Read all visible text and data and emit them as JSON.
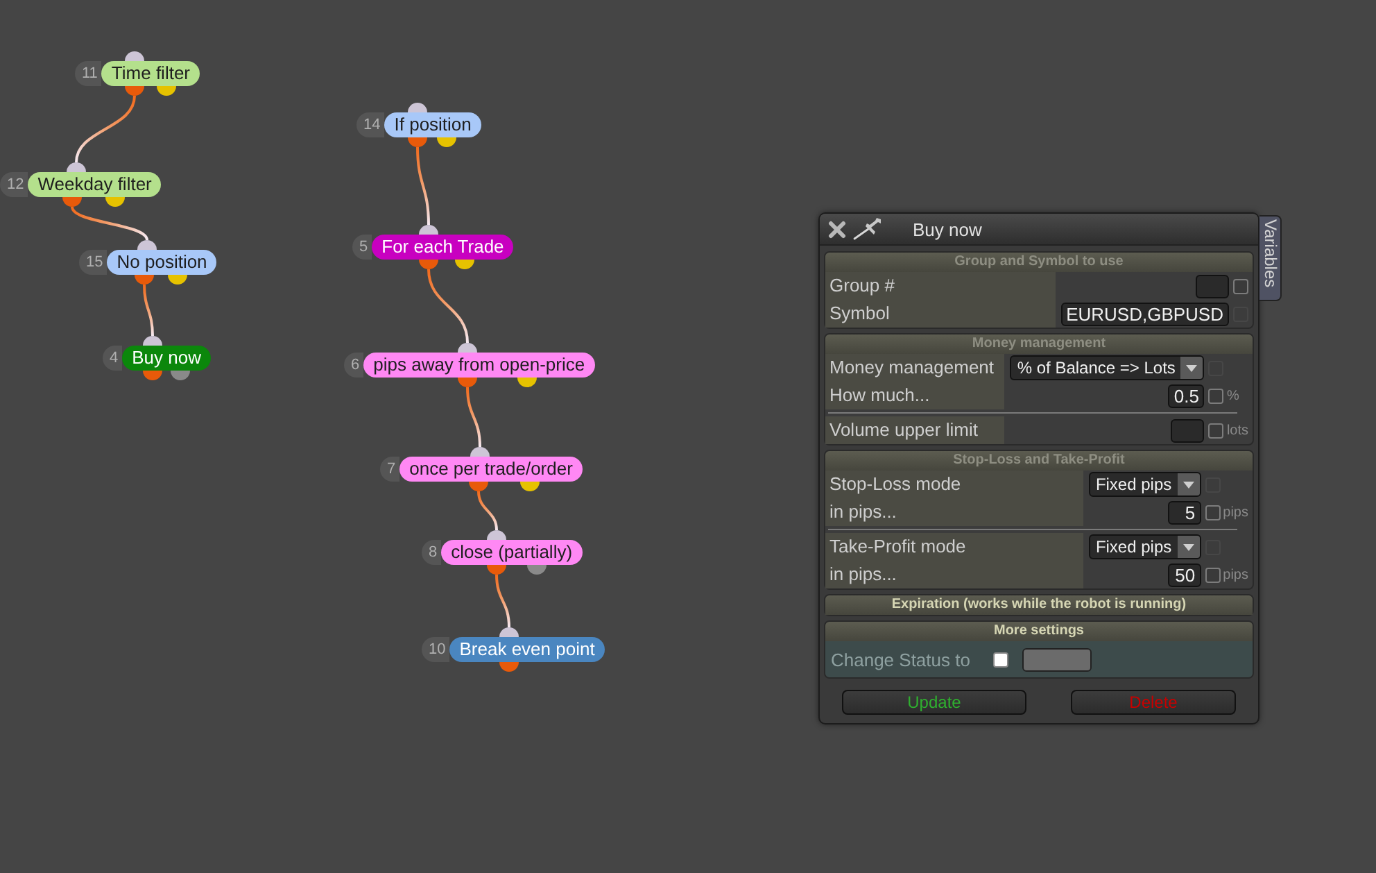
{
  "canvas": {
    "flows": [
      {
        "nodes": [
          {
            "number": "11",
            "label": "Time filter",
            "color": "#b4e08c",
            "outputs": [
              {
                "color": "#e85a0a"
              },
              {
                "color": "#e6c200"
              }
            ]
          },
          {
            "number": "12",
            "label": "Weekday filter",
            "color": "#b4e08c",
            "outputs": [
              {
                "color": "#e85a0a"
              },
              {
                "color": "#e6c200"
              }
            ]
          },
          {
            "number": "15",
            "label": "No position",
            "color": "#a8c8f8",
            "outputs": [
              {
                "color": "#e85a0a"
              },
              {
                "color": "#e6c200"
              }
            ]
          },
          {
            "number": "4",
            "label": "Buy now",
            "color": "#0b870b",
            "outputs": [
              {
                "color": "#e85a0a"
              },
              {
                "color": "#8a8a8a"
              }
            ]
          }
        ]
      },
      {
        "nodes": [
          {
            "number": "14",
            "label": "If position",
            "color": "#a8c8f8",
            "outputs": [
              {
                "color": "#e85a0a"
              },
              {
                "color": "#e6c200"
              }
            ]
          },
          {
            "number": "5",
            "label": "For each Trade",
            "color": "#c800c0",
            "outputs": [
              {
                "color": "#e85a0a"
              },
              {
                "color": "#e6c200"
              }
            ]
          },
          {
            "number": "6",
            "label": "pips away from open-price",
            "color": "#ff88f4",
            "outputs": [
              {
                "color": "#e85a0a"
              },
              {
                "color": "#e6c200"
              }
            ]
          },
          {
            "number": "7",
            "label": "once per trade/order",
            "color": "#ff88f4",
            "outputs": [
              {
                "color": "#e85a0a"
              },
              {
                "color": "#e6c200"
              }
            ]
          },
          {
            "number": "8",
            "label": "close (partially)",
            "color": "#ff88f4",
            "outputs": [
              {
                "color": "#e85a0a"
              },
              {
                "color": "#8a8a8a"
              }
            ]
          },
          {
            "number": "10",
            "label": "Break even point",
            "color": "#4a86c0",
            "outputs": [
              {
                "color": "#e85a0a"
              }
            ]
          }
        ]
      }
    ]
  },
  "panel": {
    "title": "Buy now",
    "side_tab": "Variables",
    "sections": [
      {
        "title": "Group and Symbol to use",
        "dimmed": true,
        "groups": [
          {
            "rows": [
              {
                "kind": "text",
                "label": "Group #",
                "checkbox": {
                  "checked": false,
                  "disabled": false
                }
              },
              {
                "kind": "text",
                "label": "Symbol",
                "value": "EURUSD,GBPUSD",
                "checkbox": {
                  "checked": false,
                  "disabled": true
                }
              }
            ]
          }
        ]
      },
      {
        "title": "Money management",
        "dimmed": true,
        "groups": [
          {
            "rows": [
              {
                "kind": "select",
                "label": "Money management",
                "value": "% of Balance => Lots",
                "checkbox": {
                  "checked": false,
                  "disabled": true
                }
              },
              {
                "kind": "text",
                "label": "How much...",
                "value": "0.5",
                "checkbox": {
                  "checked": false,
                  "disabled": false
                },
                "unit": "%"
              }
            ]
          },
          {
            "rows": [
              {
                "kind": "text",
                "label": "Volume upper limit",
                "checkbox": {
                  "checked": false,
                  "disabled": false
                },
                "unit": "lots"
              }
            ]
          }
        ]
      },
      {
        "title": "Stop-Loss and Take-Profit",
        "dimmed": true,
        "groups": [
          {
            "rows": [
              {
                "kind": "select",
                "label": "Stop-Loss mode",
                "value": "Fixed pips",
                "checkbox": {
                  "checked": false,
                  "disabled": true
                }
              },
              {
                "kind": "text",
                "label": "in pips...",
                "value": "5",
                "checkbox": {
                  "checked": false,
                  "disabled": false
                },
                "unit": "pips"
              }
            ]
          },
          {
            "rows": [
              {
                "kind": "select",
                "label": "Take-Profit mode",
                "value": "Fixed pips",
                "checkbox": {
                  "checked": false,
                  "disabled": true
                }
              },
              {
                "kind": "text",
                "label": "in pips...",
                "value": "50",
                "checkbox": {
                  "checked": false,
                  "disabled": false
                },
                "unit": "pips"
              }
            ]
          }
        ]
      },
      {
        "title": "Expiration (works while the robot is running)",
        "dimmed": false
      },
      {
        "title": "More settings",
        "dimmed": false,
        "groups": [
          {
            "rows": [
              {
                "kind": "status",
                "label": "Change Status to",
                "checkbox": {
                  "checked": false
                }
              }
            ]
          }
        ]
      }
    ],
    "buttons": [
      {
        "label": "Update",
        "kind": "positive"
      },
      {
        "label": "Delete",
        "kind": "negative"
      }
    ]
  }
}
